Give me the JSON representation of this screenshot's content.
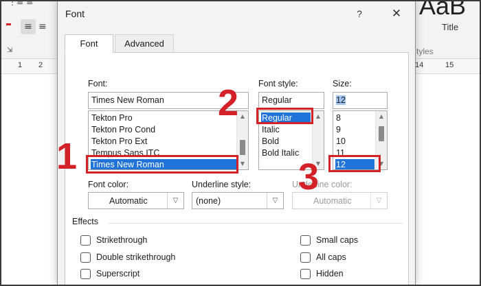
{
  "background": {
    "style_preview": "AaB",
    "style_title": "Title",
    "styles_group_label": "tyles",
    "ruler_numbers_left": [
      "1",
      "2"
    ],
    "ruler_numbers_right": [
      "14",
      "15"
    ]
  },
  "dialog": {
    "title": "Font",
    "help": "?",
    "close": "✕",
    "tabs": [
      {
        "label": "Font",
        "active": true
      },
      {
        "label": "Advanced",
        "active": false
      }
    ],
    "font": {
      "label": "Font:",
      "value": "Times New Roman",
      "items": [
        "Tekton Pro",
        "Tekton Pro Cond",
        "Tekton Pro Ext",
        "Tempus Sans ITC",
        "Times New Roman"
      ],
      "selected_index": 4
    },
    "font_style": {
      "label": "Font style:",
      "value": "Regular",
      "items": [
        "Regular",
        "Italic",
        "Bold",
        "Bold Italic"
      ],
      "selected_index": 0
    },
    "size": {
      "label": "Size:",
      "value": "12",
      "items": [
        "8",
        "9",
        "10",
        "11",
        "12"
      ],
      "selected_index": 4
    },
    "font_color": {
      "label": "Font color:",
      "value": "Automatic"
    },
    "underline_style": {
      "label": "Underline style:",
      "value": "(none)"
    },
    "underline_color": {
      "label": "Underline color:",
      "value": "Automatic",
      "disabled": true
    },
    "effects": {
      "label": "Effects",
      "left": [
        "Strikethrough",
        "Double strikethrough",
        "Superscript"
      ],
      "right": [
        "Small caps",
        "All caps",
        "Hidden"
      ]
    }
  },
  "annotations": {
    "color": "#d42027",
    "numbers": [
      "1",
      "2",
      "3"
    ]
  },
  "colors": {
    "selection": "#1f73d9",
    "dialog_bg": "#f3f3f3"
  }
}
